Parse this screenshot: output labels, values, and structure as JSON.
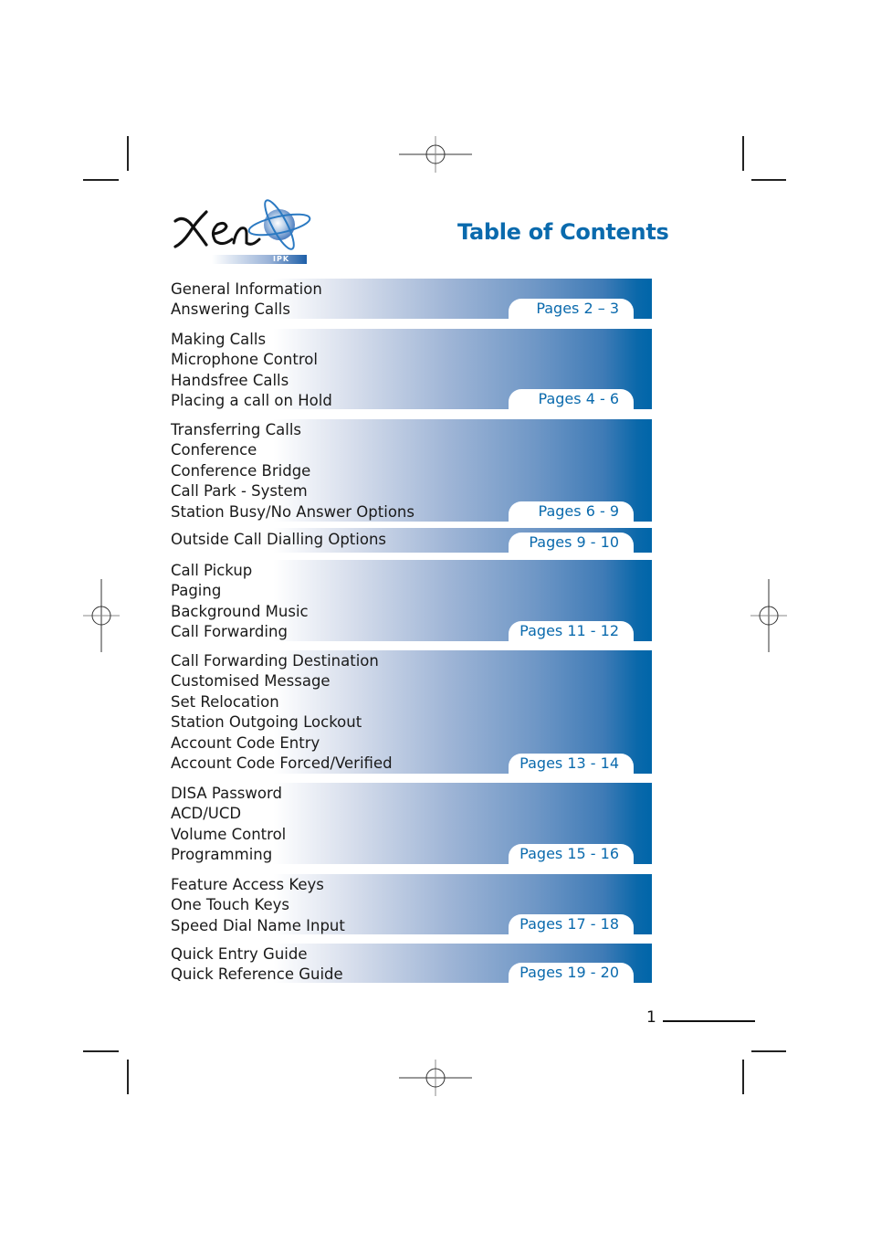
{
  "header": {
    "logo_text": "Xen",
    "logo_subtext": "IPK",
    "title": "Table of Contents"
  },
  "colors": {
    "brand_blue": "#0a6aad",
    "band_dark": "#0066a9"
  },
  "sections": [
    {
      "items": [
        "General Information",
        "Answering Calls"
      ],
      "pages": "Pages 2 – 3"
    },
    {
      "items": [
        "Making Calls",
        "Microphone Control",
        "Handsfree Calls",
        "Placing a call on Hold"
      ],
      "pages": "Pages 4 - 6"
    },
    {
      "items": [
        "Transferring Calls",
        "Conference",
        "Conference Bridge",
        "Call Park - System",
        "Station Busy/No Answer Options"
      ],
      "pages": "Pages 6 - 9"
    },
    {
      "items": [
        "Outside Call Dialling Options"
      ],
      "pages": "Pages 9 - 10"
    },
    {
      "items": [
        "Call Pickup",
        "Paging",
        "Background Music",
        "Call Forwarding"
      ],
      "pages": "Pages 11 - 12"
    },
    {
      "items": [
        "Call Forwarding Destination",
        "Customised Message",
        "Set Relocation",
        "Station Outgoing Lockout",
        "Account Code Entry",
        "Account Code Forced/Verified"
      ],
      "pages": "Pages 13 - 14"
    },
    {
      "items": [
        "DISA Password",
        "ACD/UCD",
        "Volume Control",
        "Programming"
      ],
      "pages": "Pages 15 - 16"
    },
    {
      "items": [
        "Feature Access Keys",
        "One Touch Keys",
        "Speed Dial Name Input"
      ],
      "pages": "Pages 17 - 18"
    },
    {
      "items": [
        "Quick Entry Guide",
        "Quick Reference Guide"
      ],
      "pages": "Pages 19 - 20"
    }
  ],
  "footer": {
    "page_number": "1"
  }
}
